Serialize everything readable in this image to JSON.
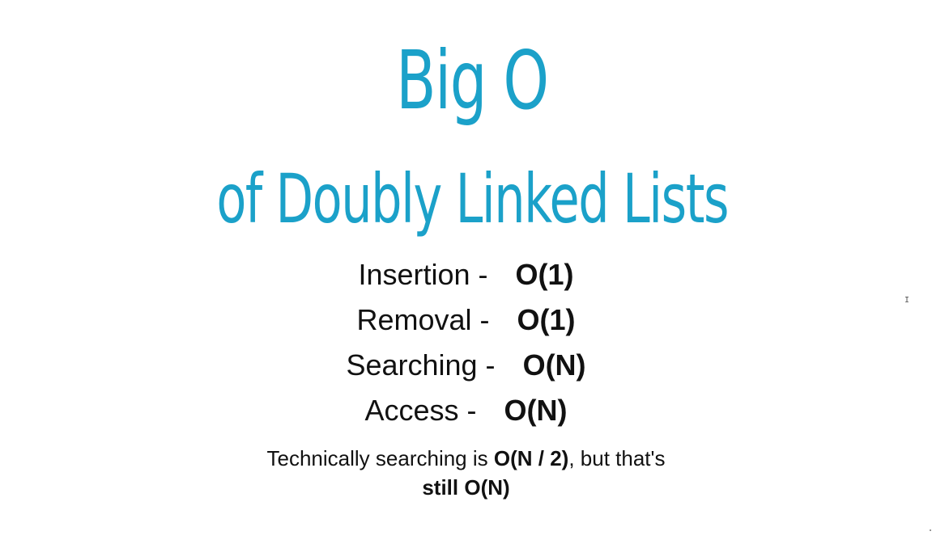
{
  "slide": {
    "title_line1": "Big O",
    "title_line2": "of Doubly Linked Lists",
    "title_color": "#1ba1c9",
    "operations": [
      {
        "label": "Insertion -",
        "value": "O(1)"
      },
      {
        "label": "Removal -",
        "value": "O(1)"
      },
      {
        "label": "Searching -",
        "value": "O(N)"
      },
      {
        "label": "Access -",
        "value": "O(N)"
      }
    ],
    "note": {
      "part1": "Technically searching is ",
      "part2_bold": "O(N / 2)",
      "part3": ", but that's",
      "line2_bold": "still O(N)"
    },
    "cursor_glyph": "I"
  }
}
